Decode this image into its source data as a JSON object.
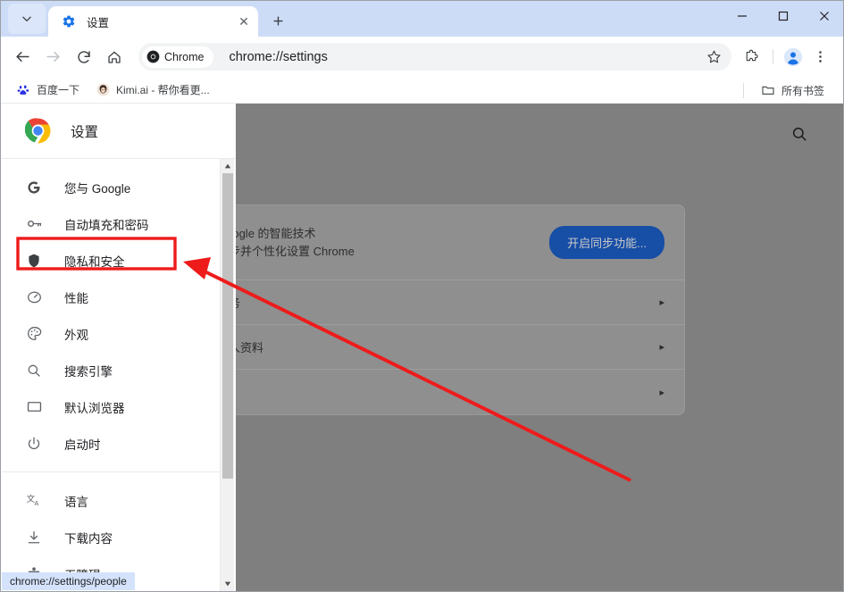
{
  "window": {
    "controls": [
      {
        "name": "minimize",
        "glyph": "—"
      },
      {
        "name": "maximize",
        "glyph": "□"
      },
      {
        "name": "close",
        "glyph": "✕"
      }
    ]
  },
  "tabstrip": {
    "tab_search_icon": "chevron-down-icon",
    "tabs": [
      {
        "title": "设置",
        "favicon": "settings-gear-icon",
        "active": true,
        "close_glyph": "✕"
      }
    ],
    "new_tab_glyph": "+"
  },
  "toolbar": {
    "back_icon": "←",
    "forward_icon": "→",
    "reload_icon": "reload-icon",
    "home_icon": "home-icon",
    "chrome_chip_label": "Chrome",
    "url": "chrome://settings",
    "star_icon": "bookmark-star-icon",
    "extensions_icon": "extensions-puzzle-icon",
    "profile_icon": "profile-avatar-icon",
    "menu_icon": "three-dot-menu-icon"
  },
  "bookmarks": {
    "items": [
      {
        "label": "百度一下",
        "favicon": "baidu-paw-icon"
      },
      {
        "label": "Kimi.ai - 帮你看更...",
        "favicon": "kimi-avatar-icon"
      }
    ],
    "all_bookmarks_label": "所有书签",
    "all_bookmarks_icon": "folder-icon"
  },
  "settings": {
    "header_title": "设置",
    "header_icon": "chrome-logo-icon",
    "nav_groups": [
      {
        "items": [
          {
            "label": "您与 Google",
            "icon": "google-g-icon"
          },
          {
            "label": "自动填充和密码",
            "icon": "key-icon"
          },
          {
            "label": "隐私和安全",
            "icon": "shield-icon",
            "highlighted": true
          },
          {
            "label": "性能",
            "icon": "speedometer-icon"
          },
          {
            "label": "外观",
            "icon": "palette-icon"
          },
          {
            "label": "搜索引擎",
            "icon": "search-icon"
          },
          {
            "label": "默认浏览器",
            "icon": "window-icon"
          },
          {
            "label": "启动时",
            "icon": "power-icon"
          }
        ]
      },
      {
        "items": [
          {
            "label": "语言",
            "icon": "translate-icon"
          },
          {
            "label": "下载内容",
            "icon": "download-icon"
          },
          {
            "label": "无障碍",
            "icon": "accessibility-icon"
          }
        ]
      }
    ]
  },
  "main": {
    "search_icon": "search-icon",
    "card_rows": [
      {
        "type": "sync",
        "line1": "Google 的智能技术",
        "line2": "同步并个性化设置 Chrome",
        "button_label": "开启同步功能..."
      },
      {
        "type": "link",
        "label": "服务",
        "chevron": "▸"
      },
      {
        "type": "link",
        "label": "个人资料",
        "chevron": "▸"
      },
      {
        "type": "link",
        "label": "",
        "chevron": "▸"
      }
    ]
  },
  "annotation": {
    "highlight_color": "#ee1b1b",
    "arrow_color": "#ee1b1b",
    "highlight_target": "隐私和安全"
  },
  "statusbar": {
    "text": "chrome://settings/people"
  },
  "colors": {
    "tabstrip_bg": "#cddcf6",
    "tab_active_bg": "#ffffff",
    "omnibox_bg": "#f1f3f4",
    "scrim": "#7f7f7f",
    "sync_button": "#174ea6",
    "status_bg": "#d4e2fb"
  }
}
